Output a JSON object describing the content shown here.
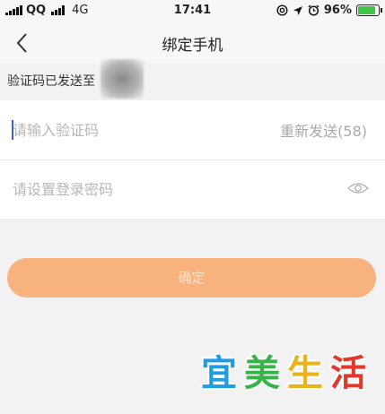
{
  "status_bar": {
    "carrier": "QQ",
    "network": "4G",
    "time": "17:41",
    "battery_percent": "96%",
    "battery_level": 0.96,
    "icons": [
      "signal-icon",
      "at-icon",
      "location-arrow-icon",
      "alarm-icon",
      "battery-icon"
    ]
  },
  "nav": {
    "title": "绑定手机",
    "back_icon": "chevron-left-icon"
  },
  "hint": {
    "text": "验证码已发送至"
  },
  "code_field": {
    "placeholder": "请输入验证码",
    "value": "",
    "resend_label": "重新发送(58)"
  },
  "password_field": {
    "placeholder": "请设置登录密码",
    "value": "",
    "toggle_icon": "eye-icon"
  },
  "confirm_button": {
    "label": "确定"
  },
  "watermark": {
    "chars": [
      "宜",
      "美",
      "生",
      "活"
    ]
  },
  "colors": {
    "accent": "#f8b27e",
    "page_bg": "#f2f2f2",
    "battery": "#3ec446",
    "logo": [
      "#1f9de0",
      "#37b34a",
      "#e7b41b",
      "#e0392b"
    ]
  }
}
